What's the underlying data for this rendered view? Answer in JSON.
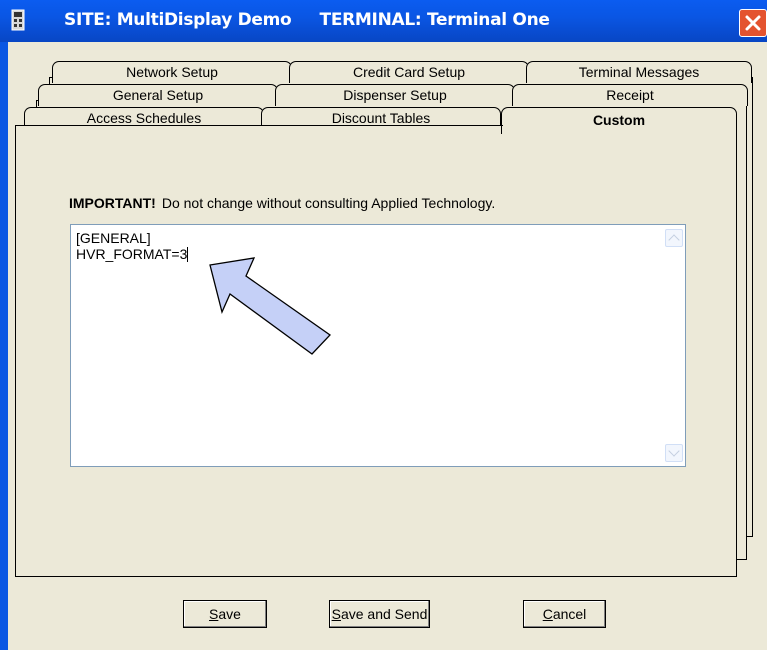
{
  "window": {
    "title": "SITE: MultiDisplay Demo     TERMINAL: Terminal One"
  },
  "tabs": {
    "row1": [
      "Network Setup",
      "Credit Card Setup",
      "Terminal Messages"
    ],
    "row2": [
      "General Setup",
      "Dispenser Setup",
      "Receipt"
    ],
    "row3": [
      "Access Schedules",
      "Discount Tables",
      "Custom"
    ],
    "active": "Custom"
  },
  "custom": {
    "warning_label": "IMPORTANT!",
    "warning_text": "Do not change without consulting Applied Technology.",
    "config_lines": [
      "[GENERAL]",
      "HVR_FORMAT=3"
    ]
  },
  "buttons": {
    "save": {
      "mnemonic": "S",
      "rest": "ave"
    },
    "save_send": {
      "mnemonic": "S",
      "rest": "ave and Send"
    },
    "cancel": {
      "mnemonic": "C",
      "rest": "ancel"
    }
  },
  "colors": {
    "titlebar": "#0a57e3",
    "dialog_bg": "#ece9d8",
    "close_button": "#e4532f",
    "annotation_arrow": "#c5d0f7"
  }
}
